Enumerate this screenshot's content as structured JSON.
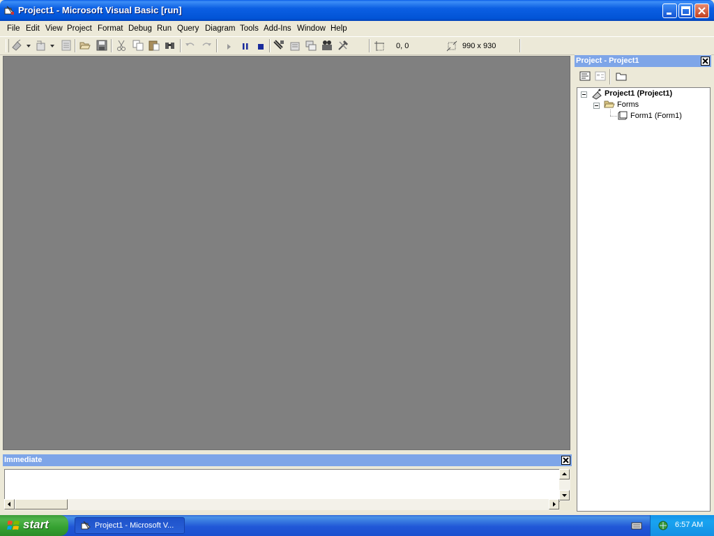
{
  "window": {
    "title": "Project1 - Microsoft Visual Basic [run]",
    "app_icon": "vb-ide-icon",
    "buttons": [
      "minimize-icon",
      "maximize-icon",
      "close-icon"
    ]
  },
  "menubar": {
    "items": [
      "File",
      "Edit",
      "View",
      "Project",
      "Format",
      "Debug",
      "Run",
      "Query",
      "Diagram",
      "Tools",
      "Add-Ins",
      "Window",
      "Help"
    ]
  },
  "toolbar": {
    "icons": [
      "add-project-icon",
      "add-form-icon",
      "menu-editor-icon",
      "open-icon",
      "save-icon",
      "cut-icon",
      "copy-icon",
      "paste-icon",
      "find-icon",
      "undo-icon",
      "redo-icon",
      "start-icon",
      "break-icon",
      "end-icon",
      "project-explorer-icon",
      "properties-icon",
      "form-layout-icon",
      "object-browser-icon",
      "toolbox-icon"
    ],
    "position_label": "0, 0",
    "size_label": "990 x 930"
  },
  "immediate": {
    "title": "Immediate",
    "content": ""
  },
  "project": {
    "title": "Project - Project1",
    "tools": [
      "view-code-icon",
      "view-object-icon",
      "toggle-folders-icon"
    ],
    "tree": {
      "root": "Project1 (Project1)",
      "folder": "Forms",
      "leaf": "Form1 (Form1)"
    }
  },
  "taskbar": {
    "start_label": "start",
    "task_label": "Project1 - Microsoft V...",
    "clock": "6:57 AM"
  },
  "colors": {
    "title_blue": "#0254d6",
    "workspace_gray": "#808080",
    "panel_title": "#7ea5e8",
    "taskbar_blue": "#2157d7",
    "start_green": "#35a131"
  }
}
